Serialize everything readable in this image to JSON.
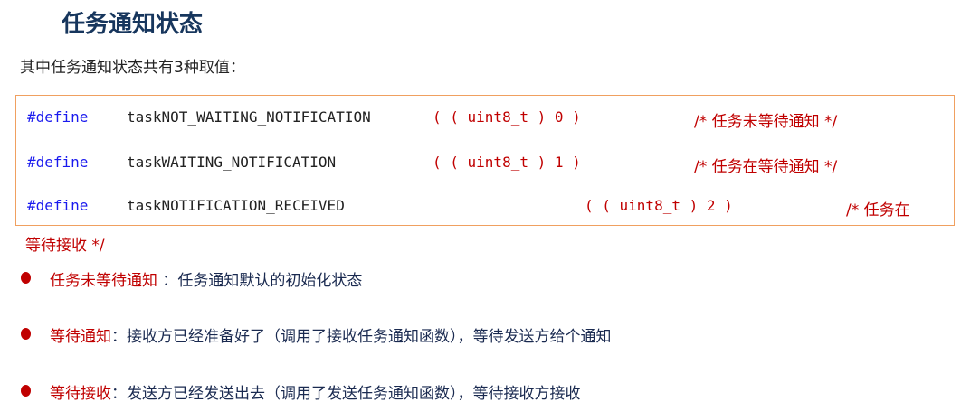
{
  "title": "任务通知状态",
  "intro": "其中任务通知状态共有3种取值：",
  "defines": [
    {
      "keyword": "#define",
      "name": "taskNOT_WAITING_NOTIFICATION",
      "value": "( ( uint8_t ) 0 )",
      "comment": "/* 任务未等待通知 */"
    },
    {
      "keyword": "#define",
      "name": "taskWAITING_NOTIFICATION",
      "value": "( ( uint8_t ) 1 )",
      "comment": "/* 任务在等待通知 */"
    },
    {
      "keyword": "#define",
      "name": "taskNOTIFICATION_RECEIVED",
      "value": "( ( uint8_t ) 2 )",
      "comment": "/* 任务在"
    }
  ],
  "overflow": "等待接收 */",
  "bullets": [
    {
      "term": "任务未等待通知",
      "desc": " ：任务通知默认的初始化状态"
    },
    {
      "term": "等待通知",
      "desc": "：接收方已经准备好了（调用了接收任务通知函数），等待发送方给个通知"
    },
    {
      "term": "等待接收",
      "desc": "：发送方已经发送出去（调用了发送任务通知函数），等待接收方接收"
    }
  ]
}
